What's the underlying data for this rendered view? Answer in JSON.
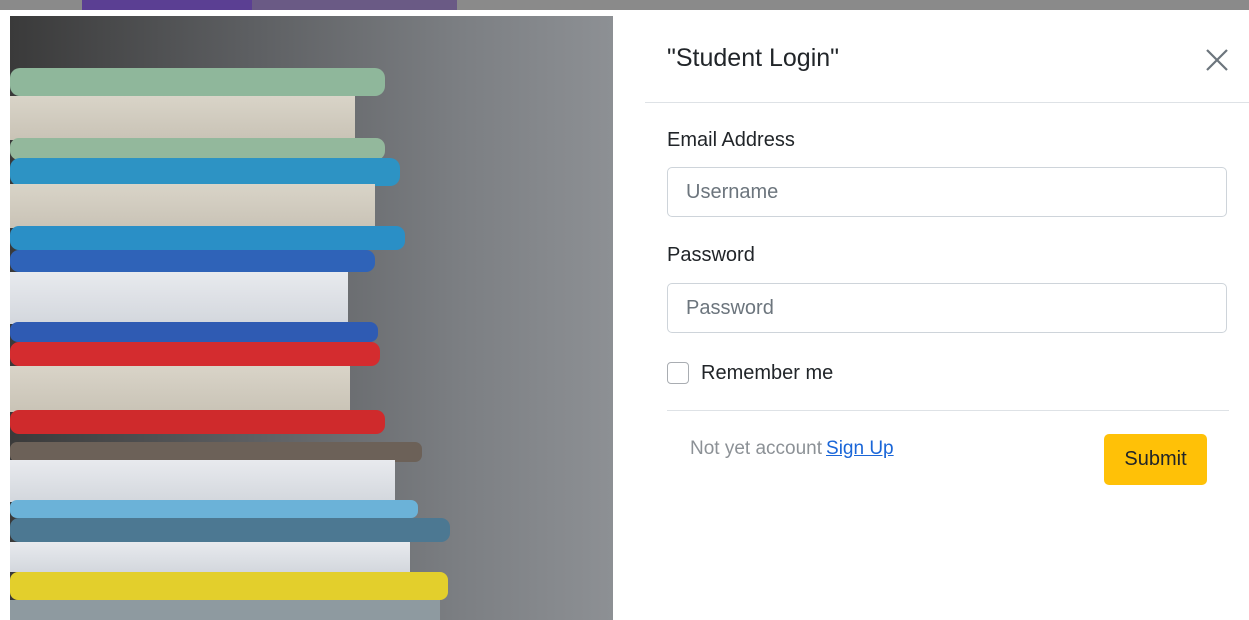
{
  "modal": {
    "title": "\"Student Login\"",
    "close_icon": "close-x-icon",
    "email": {
      "label": "Email Address",
      "placeholder": "Username",
      "value": ""
    },
    "password": {
      "label": "Password",
      "placeholder": "Password",
      "value": ""
    },
    "remember": {
      "label": "Remember me",
      "checked": false
    },
    "signup": {
      "prompt": "Not yet account",
      "link_label": "Sign Up"
    },
    "submit_label": "Submit"
  },
  "colors": {
    "submit_button": "#ffc107",
    "link": "#1a66d8",
    "top_bar_accent": "#5b3f93"
  },
  "image": {
    "description_icon": "book-stack-photo"
  }
}
